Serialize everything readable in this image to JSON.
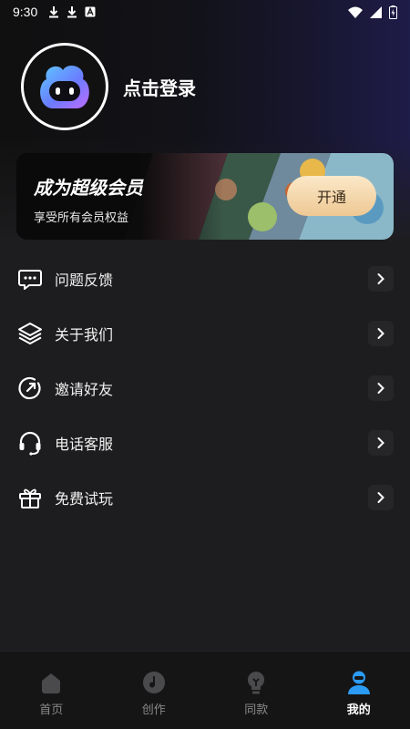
{
  "status_bar": {
    "time": "9:30",
    "icons_left": [
      "download-icon",
      "download-icon",
      "notification-icon"
    ],
    "icons_right": [
      "wifi-icon",
      "signal-icon",
      "battery-icon"
    ]
  },
  "profile": {
    "login_label": "点击登录",
    "avatar_icon": "robot-face-icon"
  },
  "vip": {
    "title": "成为超级会员",
    "subtitle": "享受所有会员权益",
    "button_label": "开通",
    "accent_gradient": [
      "#fbe8c8",
      "#eec894"
    ]
  },
  "menu": {
    "items": [
      {
        "label": "问题反馈",
        "icon": "feedback-icon"
      },
      {
        "label": "关于我们",
        "icon": "layers-icon"
      },
      {
        "label": "邀请好友",
        "icon": "invite-icon"
      },
      {
        "label": "电话客服",
        "icon": "headset-icon"
      },
      {
        "label": "免费试玩",
        "icon": "gift-icon"
      }
    ]
  },
  "tabbar": {
    "tabs": [
      {
        "label": "首页",
        "icon": "home-icon",
        "active": false
      },
      {
        "label": "创作",
        "icon": "create-icon",
        "active": false
      },
      {
        "label": "同款",
        "icon": "bulb-icon",
        "active": false
      },
      {
        "label": "我的",
        "icon": "user-icon",
        "active": true
      }
    ],
    "active_color": "#3aa7ff"
  }
}
